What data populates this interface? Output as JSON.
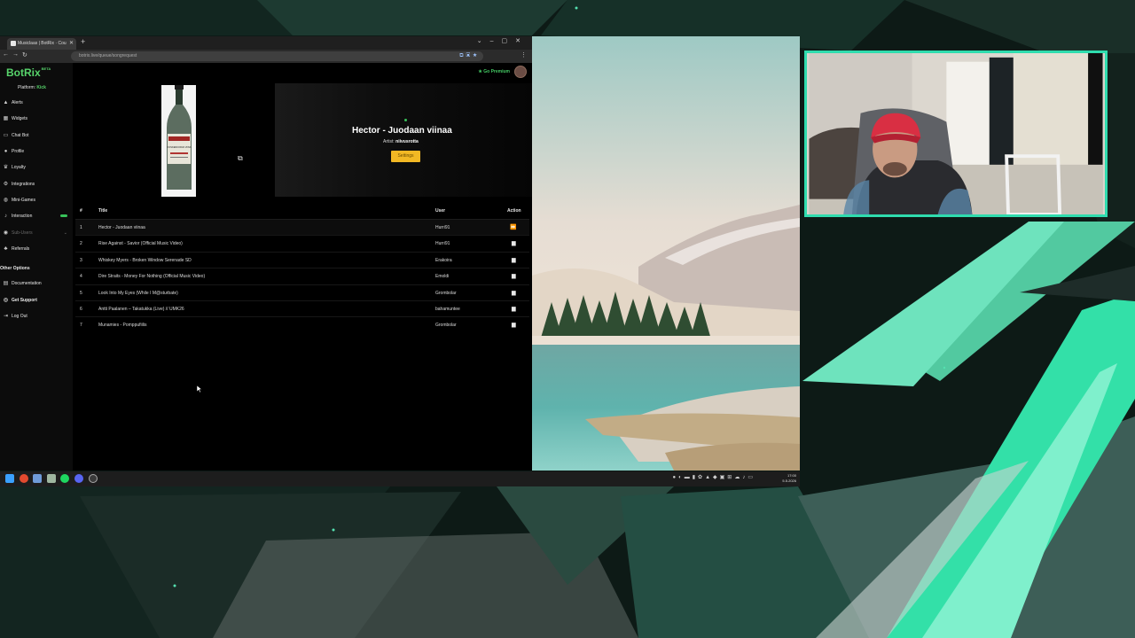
{
  "browser": {
    "tab_title": "Musiclaas | BotRix · Cou",
    "url": "botrix.live/queue/songrequest"
  },
  "app": {
    "brand": "BotRix",
    "brand_badge": "BETA",
    "platform_label": "Platform:",
    "platform_value": "Kick",
    "go_premium": "Go Premium",
    "nav": [
      {
        "label": "Alerts",
        "icon": "bell-icon"
      },
      {
        "label": "Widgets",
        "icon": "widgets-icon"
      },
      {
        "label": "Chat Bot",
        "icon": "chat-icon"
      },
      {
        "label": "Profile",
        "icon": "user-icon"
      },
      {
        "label": "Loyalty",
        "icon": "trophy-icon"
      },
      {
        "label": "Integrations",
        "icon": "plug-icon"
      },
      {
        "label": "Mini-Games",
        "icon": "gamepad-icon"
      },
      {
        "label": "Interaction",
        "icon": "music-icon"
      },
      {
        "label": "Sub-Users",
        "icon": "users-icon"
      },
      {
        "label": "Referrals",
        "icon": "referral-icon"
      }
    ],
    "other_options": "Other Options",
    "nav_other": [
      {
        "label": "Documentation",
        "icon": "document-icon"
      },
      {
        "label": "Get Support",
        "icon": "support-icon"
      },
      {
        "label": "Log Out",
        "icon": "logout-icon"
      }
    ]
  },
  "now_playing": {
    "title": "Hector - Juodaan viinaa",
    "artist_label": "Artist:",
    "artist": "niivusrotta",
    "settings_label": "Settings",
    "bottle_label": "KOSKENKORVA VIINA"
  },
  "queue": {
    "headers": {
      "num": "#",
      "title": "Title",
      "user": "User",
      "action": "Action"
    },
    "rows": [
      {
        "num": "1",
        "title": "Hector - Juodaan viinaa",
        "user": "Hurri91",
        "action": "skip"
      },
      {
        "num": "2",
        "title": "Rise Against - Savior (Official Music Video)",
        "user": "Hurri91",
        "action": "delete"
      },
      {
        "num": "3",
        "title": "Whiskey Myers - Broken Window Serenade SD",
        "user": "Erakoira",
        "action": "delete"
      },
      {
        "num": "4",
        "title": "Dire Straits - Money For Nothing (Official Music Video)",
        "user": "Emoldi",
        "action": "delete"
      },
      {
        "num": "5",
        "title": "Look Into My Eyes (While I M@sturbate)",
        "user": "Grombolar",
        "action": "delete"
      },
      {
        "num": "6",
        "title": "Antti Paalanen – Takatukka (Live) // UMK26",
        "user": "bahamuntee",
        "action": "delete"
      },
      {
        "num": "7",
        "title": "Munamies - Pomppufiilis",
        "user": "Grombolar",
        "action": "delete"
      }
    ]
  },
  "taskbar": {
    "clock_time": "17:00",
    "clock_date": "5.5.2026"
  },
  "colors": {
    "accent_green": "#38c25a",
    "settings_yellow": "#f2b824",
    "webcam_border": "#2fdcae"
  }
}
